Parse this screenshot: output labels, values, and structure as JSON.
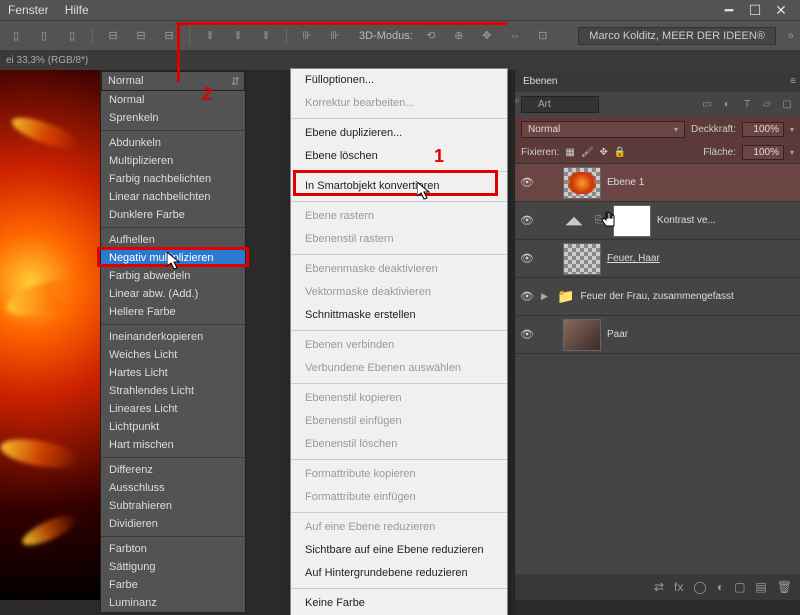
{
  "menubar": {
    "items": [
      "Fenster",
      "Hilfe"
    ]
  },
  "toolbar": {
    "mode3d_label": "3D-Modus:",
    "right_label": "Marco Kolditz, MEER DER IDEEN®"
  },
  "tabbar": {
    "text": "ei 33,3% (RGB/8*)"
  },
  "blend_dropdown": {
    "current": "Normal",
    "groups": [
      [
        "Normal",
        "Sprenkeln"
      ],
      [
        "Abdunkeln",
        "Multiplizieren",
        "Farbig nachbelichten",
        "Linear nachbelichten",
        "Dunklere Farbe"
      ],
      [
        "Aufhellen",
        "Negativ multiplizieren",
        "Farbig abwedeln",
        "Linear abw. (Add.)",
        "Hellere Farbe"
      ],
      [
        "Ineinanderkopieren",
        "Weiches Licht",
        "Hartes Licht",
        "Strahlendes Licht",
        "Lineares Licht",
        "Lichtpunkt",
        "Hart mischen"
      ],
      [
        "Differenz",
        "Ausschluss",
        "Subtrahieren",
        "Dividieren"
      ],
      [
        "Farbton",
        "Sättigung",
        "Farbe",
        "Luminanz"
      ]
    ],
    "selected": "Negativ multiplizieren"
  },
  "context_menu": {
    "groups": [
      [
        {
          "t": "Fülloptionen...",
          "d": false
        },
        {
          "t": "Korrektur bearbeiten...",
          "d": true
        }
      ],
      [
        {
          "t": "Ebene duplizieren...",
          "d": false
        },
        {
          "t": "Ebene löschen",
          "d": false
        }
      ],
      [
        {
          "t": "In Smartobjekt konvertieren",
          "d": false
        }
      ],
      [
        {
          "t": "Ebene rastern",
          "d": true
        },
        {
          "t": "Ebenenstil rastern",
          "d": true
        }
      ],
      [
        {
          "t": "Ebenenmaske deaktivieren",
          "d": true
        },
        {
          "t": "Vektormaske deaktivieren",
          "d": true
        },
        {
          "t": "Schnittmaske erstellen",
          "d": false
        }
      ],
      [
        {
          "t": "Ebenen verbinden",
          "d": true
        },
        {
          "t": "Verbundene Ebenen auswählen",
          "d": true
        }
      ],
      [
        {
          "t": "Ebenenstil kopieren",
          "d": true
        },
        {
          "t": "Ebenenstil einfügen",
          "d": true
        },
        {
          "t": "Ebenenstil löschen",
          "d": true
        }
      ],
      [
        {
          "t": "Formattribute kopieren",
          "d": true
        },
        {
          "t": "Formattribute einfügen",
          "d": true
        }
      ],
      [
        {
          "t": "Auf eine Ebene reduzieren",
          "d": true
        },
        {
          "t": "Sichtbare auf eine Ebene reduzieren",
          "d": false
        },
        {
          "t": "Auf Hintergrundebene reduzieren",
          "d": false
        }
      ],
      [
        {
          "t": "Keine Farbe",
          "d": false
        }
      ]
    ]
  },
  "layers_panel": {
    "tab": "Ebenen",
    "search_label": "Art",
    "blend_mode": "Normal",
    "opacity_label": "Deckkraft:",
    "opacity_value": "100%",
    "lock_label": "Fixieren:",
    "fill_label": "Fläche:",
    "fill_value": "100%",
    "layers": [
      {
        "name": "Ebene 1",
        "selected": true,
        "thumb": "checker-flame"
      },
      {
        "name": "Kontrast ve...",
        "thumb": "adjust",
        "mask": true
      },
      {
        "name": "Feuer, Haar",
        "thumb": "checker",
        "underline": true
      },
      {
        "name": "Feuer der Frau, zusammengefasst",
        "thumb": "folder"
      },
      {
        "name": "Paar",
        "thumb": "photo"
      }
    ]
  },
  "annotations": {
    "label1": "1",
    "label2": "2"
  }
}
